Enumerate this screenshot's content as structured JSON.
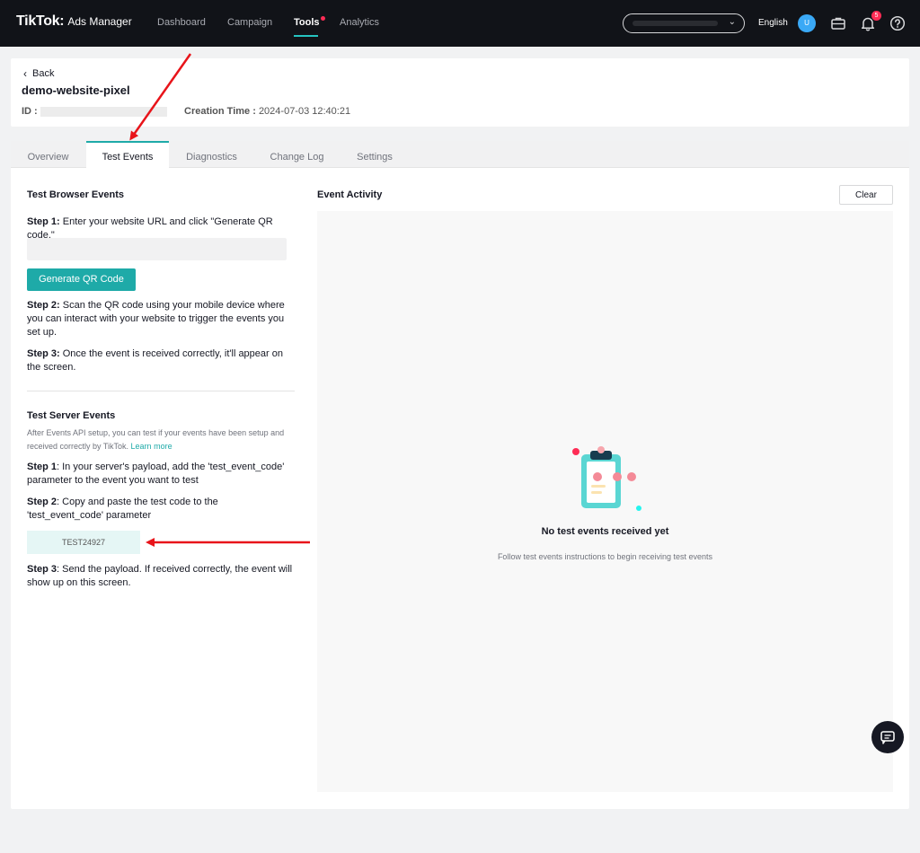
{
  "app": {
    "brand": "TikTok",
    "sub": "Ads Manager"
  },
  "nav": {
    "items": [
      {
        "label": "Dashboard"
      },
      {
        "label": "Campaign"
      },
      {
        "label": "Tools"
      },
      {
        "label": "Analytics"
      }
    ]
  },
  "topbar": {
    "language": "English",
    "avatar_initial": "U",
    "notification_count": "5"
  },
  "header": {
    "back_label": "Back",
    "pixel_name": "demo-website-pixel",
    "id_label": "ID :",
    "creation_label": "Creation Time :",
    "creation_value": "2024-07-03 12:40:21"
  },
  "tabs": [
    {
      "label": "Overview"
    },
    {
      "label": "Test Events"
    },
    {
      "label": "Diagnostics"
    },
    {
      "label": "Change Log"
    },
    {
      "label": "Settings"
    }
  ],
  "browser": {
    "title": "Test Browser Events",
    "step1_bold": "Step 1:",
    "step1_text": " Enter your website URL and click \"Generate QR code.\"",
    "button": "Generate QR Code",
    "step2_bold": "Step 2:",
    "step2_text": " Scan the QR code using your mobile device where you can interact with your website to trigger the events you set up.",
    "step3_bold": "Step 3:",
    "step3_text": " Once the event is received correctly, it'll appear on the screen."
  },
  "server": {
    "title": "Test Server Events",
    "desc": "After Events API setup, you can test if your events have been setup and received correctly by TikTok. ",
    "learn_more": "Learn more",
    "step1_bold": "Step 1",
    "step1_text": ": In your server's payload, add the 'test_event_code' parameter to the event you want to test",
    "step2_bold": "Step 2",
    "step2_text": ": Copy and paste the test code to the 'test_event_code' parameter",
    "test_code": "TEST24927",
    "step3_bold": "Step 3",
    "step3_text": ": Send the payload. If received correctly, the event will show up on this screen."
  },
  "activity": {
    "title": "Event Activity",
    "clear": "Clear",
    "empty_title": "No test events received yet",
    "empty_sub": "Follow test events instructions to begin receiving test events"
  },
  "colors": {
    "accent": "#1eaaa8",
    "nav_bg": "#111318",
    "alert": "#fe2c55"
  }
}
